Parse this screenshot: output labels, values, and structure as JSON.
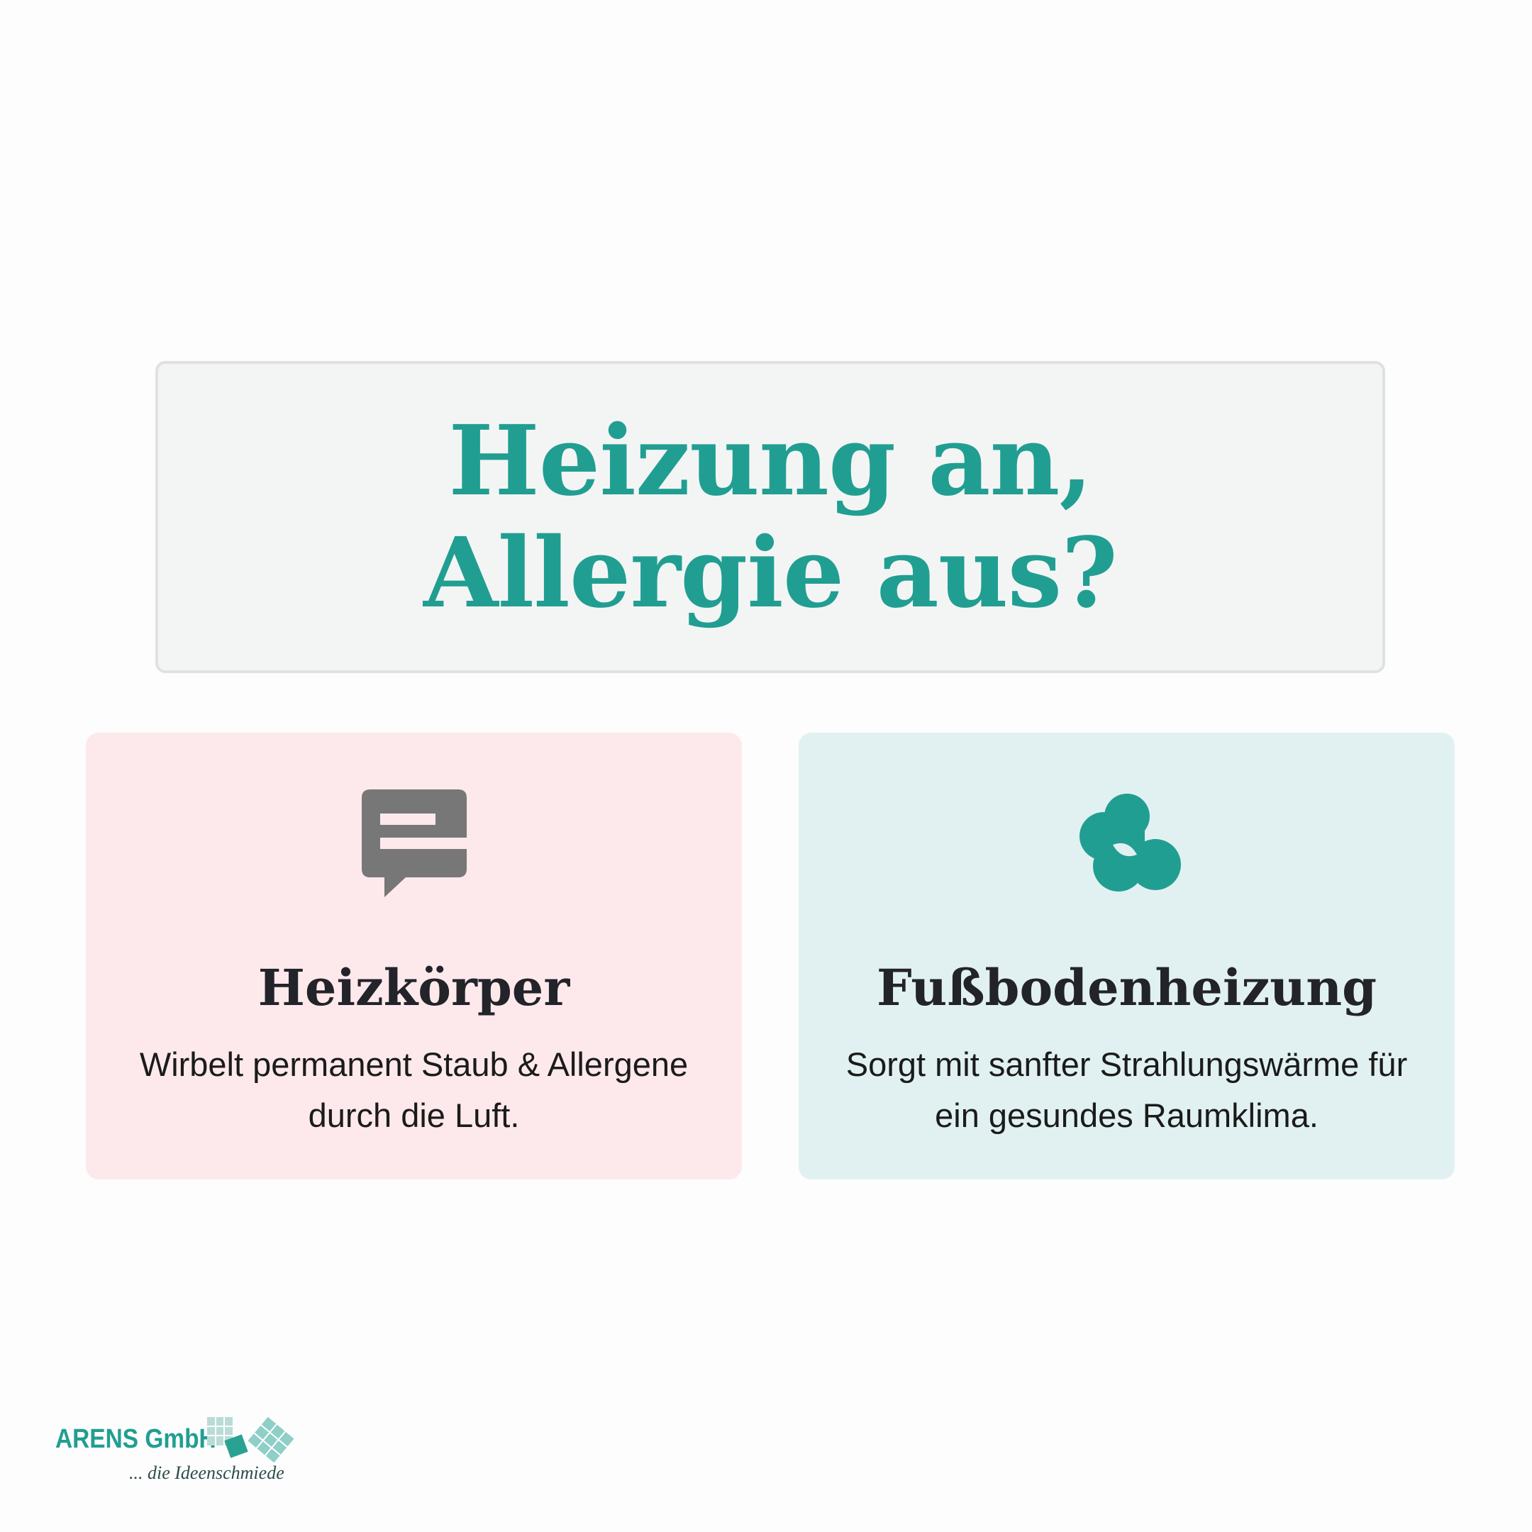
{
  "title": "Heizung an, Allergie aus?",
  "cards": [
    {
      "heading": "Heizkörper",
      "text": "Wirbelt permanent Staub & Allergene durch die Luft.",
      "icon": "speech-bubble-icon",
      "background": "#fde9eb",
      "icon_color": "#777777"
    },
    {
      "heading": "Fußbodenheizung",
      "text": "Sorgt mit sanfter Strahlungswärme für ein gesundes Raumklima.",
      "icon": "blob-cluster-icon",
      "background": "#e1f1f1",
      "icon_color": "#219e92"
    }
  ],
  "logo": {
    "name": "ARENS GmbH",
    "tagline": "... die Ideenschmiede"
  },
  "colors": {
    "accent": "#219e92",
    "text": "#23232a"
  }
}
